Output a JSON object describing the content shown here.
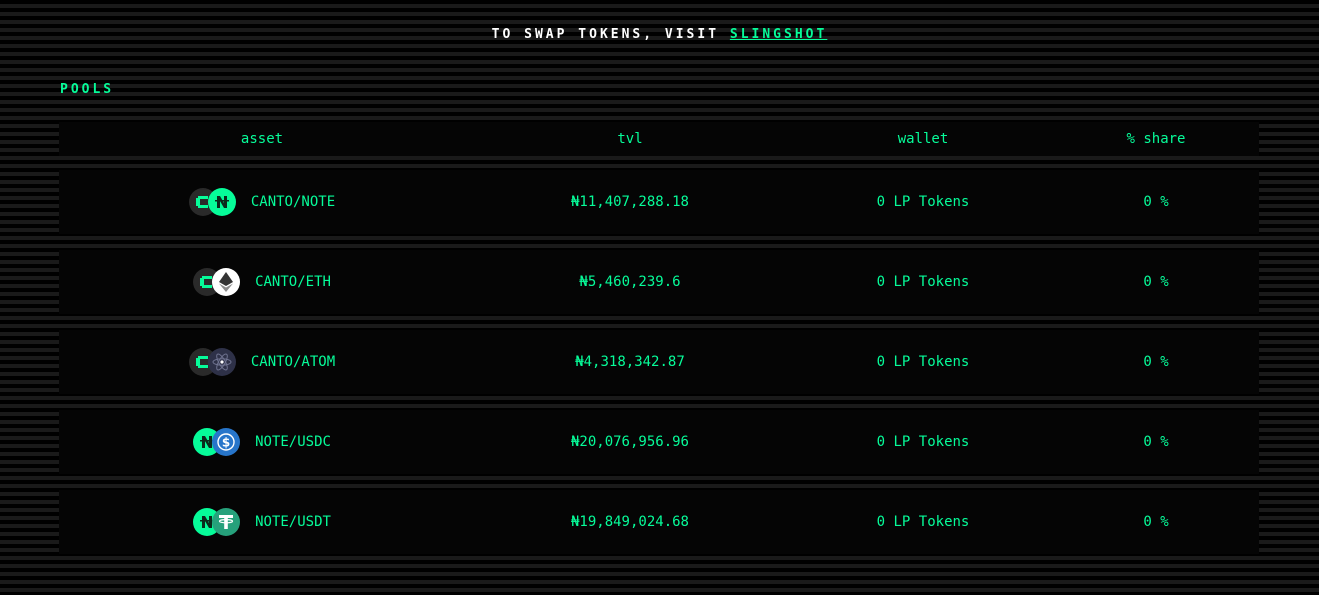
{
  "banner": {
    "prefix": "TO SWAP TOKENS, VISIT",
    "link": "SLINGSHOT"
  },
  "pools": {
    "title": "POOLS",
    "columns": [
      "asset",
      "tvl",
      "wallet",
      "% share"
    ],
    "rows": [
      {
        "asset": "CANTO/NOTE",
        "tvl": "₦11,407,288.18",
        "wallet": "0 LP Tokens",
        "share": "0 %",
        "icons": [
          "canto-icon",
          "note-icon"
        ]
      },
      {
        "asset": "CANTO/ETH",
        "tvl": "₦5,460,239.6",
        "wallet": "0 LP Tokens",
        "share": "0 %",
        "icons": [
          "canto-icon",
          "eth-icon"
        ]
      },
      {
        "asset": "CANTO/ATOM",
        "tvl": "₦4,318,342.87",
        "wallet": "0 LP Tokens",
        "share": "0 %",
        "icons": [
          "canto-icon",
          "atom-icon"
        ]
      },
      {
        "asset": "NOTE/USDC",
        "tvl": "₦20,076,956.96",
        "wallet": "0 LP Tokens",
        "share": "0 %",
        "icons": [
          "note-icon",
          "usdc-icon"
        ]
      },
      {
        "asset": "NOTE/USDT",
        "tvl": "₦19,849,024.68",
        "wallet": "0 LP Tokens",
        "share": "0 %",
        "icons": [
          "note-icon",
          "usdt-icon"
        ]
      }
    ]
  },
  "colors": {
    "accent": "#06fc99",
    "background": "#000000",
    "row_background": "#050505",
    "banner_text": "#ffffff"
  }
}
